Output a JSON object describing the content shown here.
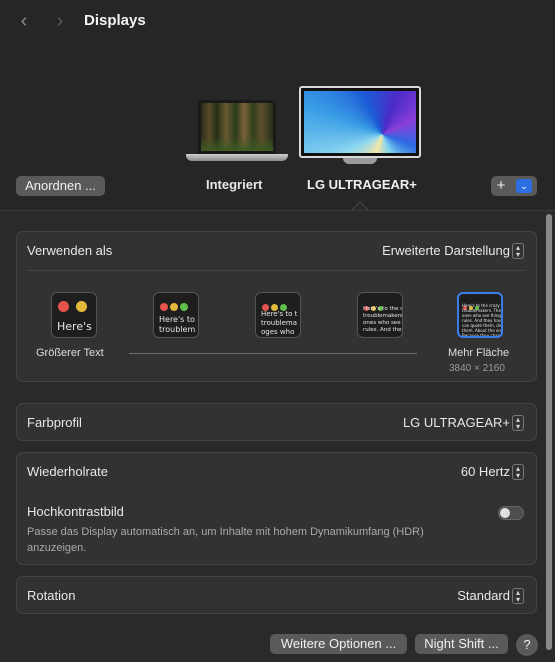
{
  "header": {
    "title": "Displays",
    "back_glyph": "‹",
    "forward_glyph": "›"
  },
  "displays": [
    {
      "name": "Integriert"
    },
    {
      "name": "LG ULTRAGEAR+"
    }
  ],
  "buttons": {
    "arrange": "Anordnen ...",
    "add": "+",
    "dropdown_glyph": "⌄",
    "more_options": "Weitere Optionen ...",
    "night_shift": "Night Shift ...",
    "help": "?"
  },
  "use_as": {
    "label": "Verwenden als",
    "value": "Erweiterte Darstellung"
  },
  "resolution": {
    "left_label": "Größerer Text",
    "right_label": "Mehr Fläche",
    "right_dimensions": "3840 × 2160",
    "previews": [
      {
        "text": "Here's"
      },
      {
        "text": "Here's to\ntroublem"
      },
      {
        "text": "Here's to t\ntroublema\noges who"
      },
      {
        "text": "Here's to the cr\ntroublemakers.\nones who see t\nrules. And they"
      },
      {
        "text": "Here's to the crazy one\ntroublemakers. The rou\nones who see things dif\nrules. And they have no\ncan quote them, disagre\nthem. About the only th\nBecause they change t"
      }
    ],
    "selected_index": 4
  },
  "color_profile": {
    "label": "Farbprofil",
    "value": "LG ULTRAGEAR+"
  },
  "refresh_rate": {
    "label": "Wiederholrate",
    "value": "60 Hertz"
  },
  "hdr": {
    "label": "Hochkontrastbild",
    "description": "Passe das Display automatisch an, um Inhalte mit hohem Dynamikumfang (HDR) anzuzeigen.",
    "enabled": false
  },
  "rotation": {
    "label": "Rotation",
    "value": "Standard"
  },
  "colors": {
    "accent": "#2c6fe0",
    "dot_red": "#e5544b",
    "dot_yellow": "#e2b93b",
    "dot_green": "#5ec04b"
  }
}
